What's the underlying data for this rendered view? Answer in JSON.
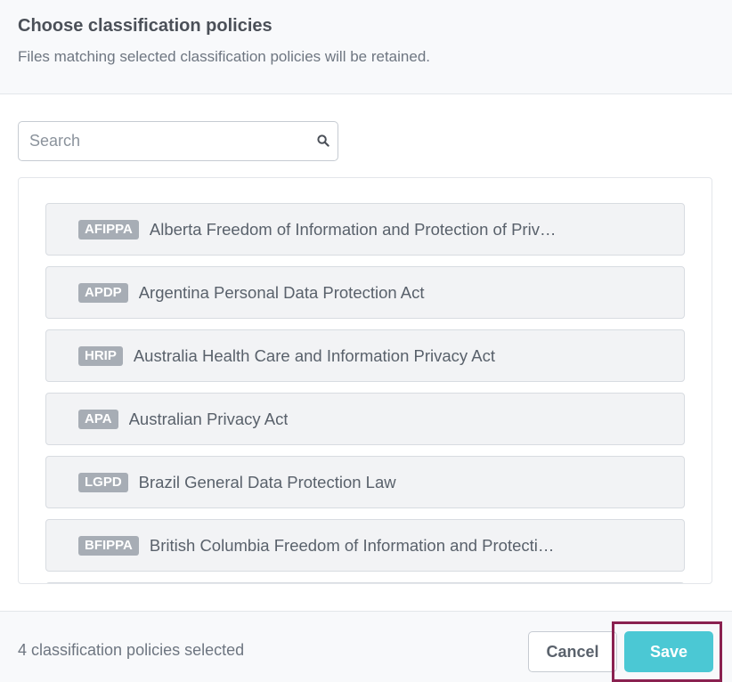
{
  "header": {
    "title": "Choose classification policies",
    "subtitle": "Files matching selected classification policies will be retained."
  },
  "search": {
    "placeholder": "Search",
    "value": "",
    "icon": "search-icon"
  },
  "policies": [
    {
      "badge": "AFIPPA",
      "label": "Alberta Freedom of Information and Protection of Priv…"
    },
    {
      "badge": "APDP",
      "label": "Argentina Personal Data Protection Act"
    },
    {
      "badge": "HRIP",
      "label": "Australia Health Care and Information Privacy Act"
    },
    {
      "badge": "APA",
      "label": "Australian Privacy Act"
    },
    {
      "badge": "LGPD",
      "label": "Brazil General Data Protection Law"
    },
    {
      "badge": "BFIPPA",
      "label": "British Columbia Freedom of Information and Protecti…"
    }
  ],
  "footer": {
    "selected_count": "4 classification policies selected",
    "cancel_label": "Cancel",
    "save_label": "Save"
  },
  "colors": {
    "accent": "#4bc8d4",
    "highlight": "#8a2150",
    "badge": "#a7adb5"
  }
}
